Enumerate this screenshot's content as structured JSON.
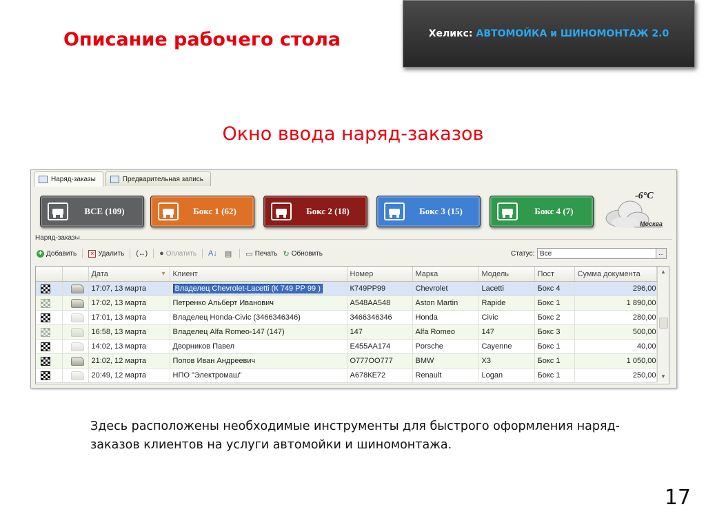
{
  "slide": {
    "title": "Описание рабочего стола",
    "brand_prefix": "Хеликс:",
    "brand_product": "АВТОМОЙКА и ШИНОМОНТАЖ 2.0",
    "section_title": "Окно ввода наряд-заказов",
    "description": "Здесь расположены необходимые инструменты для быстрого оформления наряд-заказов клиентов на услуги автомойки и шиномонтажа.",
    "page_number": "17"
  },
  "app": {
    "tabs": [
      {
        "label": "Наряд-заказы",
        "active": true
      },
      {
        "label": "Предварительная запись",
        "active": false
      }
    ],
    "boxes": [
      {
        "label": "ВСЕ (109)",
        "color": "#5f6062"
      },
      {
        "label": "Бокс 1 (62)",
        "color": "#df7127"
      },
      {
        "label": "Бокс 2 (18)",
        "color": "#8d1b18"
      },
      {
        "label": "Бокс 3 (15)",
        "color": "#3f7fd4"
      },
      {
        "label": "Бокс 4 (7)",
        "color": "#2f9a4c"
      }
    ],
    "weather": {
      "temperature": "-6°С",
      "city": "Москва",
      "icon": "cloudy-icon"
    },
    "group_label": "Наряд-заказы",
    "toolbar": {
      "add": "Добавить",
      "delete": "Удалить",
      "link": "(↔)",
      "pay": "Оплатить",
      "print": "Печать",
      "refresh": "Обновить"
    },
    "status": {
      "label": "Статус:",
      "value": "Все",
      "button": "..."
    },
    "columns": [
      "Дата",
      "Клиент",
      "Номер",
      "Марка",
      "Модель",
      "Пост",
      "Сумма документа"
    ],
    "rows": [
      {
        "date": "17:07, 13 марта",
        "client": "Владелец Chevrolet-Lacetti (К 749 РР 99 )",
        "number": "К749РР99",
        "brand": "Chevrolet",
        "model": "Lacetti",
        "post": "Бокс 4",
        "sum": "296,00"
      },
      {
        "date": "17:02, 13 марта",
        "client": "Петренко Альберт Иванович",
        "number": "А548АА548",
        "brand": "Aston Martin",
        "model": "Rapide",
        "post": "Бокс 1",
        "sum": "1 890,00"
      },
      {
        "date": "17:01, 13 марта",
        "client": "Владелец Honda-Civic (3466346346)",
        "number": "3466346346",
        "brand": "Honda",
        "model": "Civic",
        "post": "Бокс 2",
        "sum": "280,00"
      },
      {
        "date": "16:58, 13 марта",
        "client": "Владелец Alfa Romeo-147 (147)",
        "number": "147",
        "brand": "Alfa Romeo",
        "model": "147",
        "post": "Бокс 3",
        "sum": "500,00"
      },
      {
        "date": "14:02, 13 марта",
        "client": "Дворников Павел",
        "number": "Е455АА174",
        "brand": "Porsche",
        "model": "Cayenne",
        "post": "Бокс 1",
        "sum": "40,00"
      },
      {
        "date": "21:02, 12 марта",
        "client": "Попов Иван Андреевич",
        "number": "О777ОО777",
        "brand": "BMW",
        "model": "X3",
        "post": "Бокс 1",
        "sum": "1 050,00"
      },
      {
        "date": "20:49, 12 марта",
        "client": "НПО \"Электромаш\"",
        "number": "А678КЕ72",
        "brand": "Renault",
        "model": "Logan",
        "post": "Бокс 1",
        "sum": "250,00"
      }
    ]
  }
}
